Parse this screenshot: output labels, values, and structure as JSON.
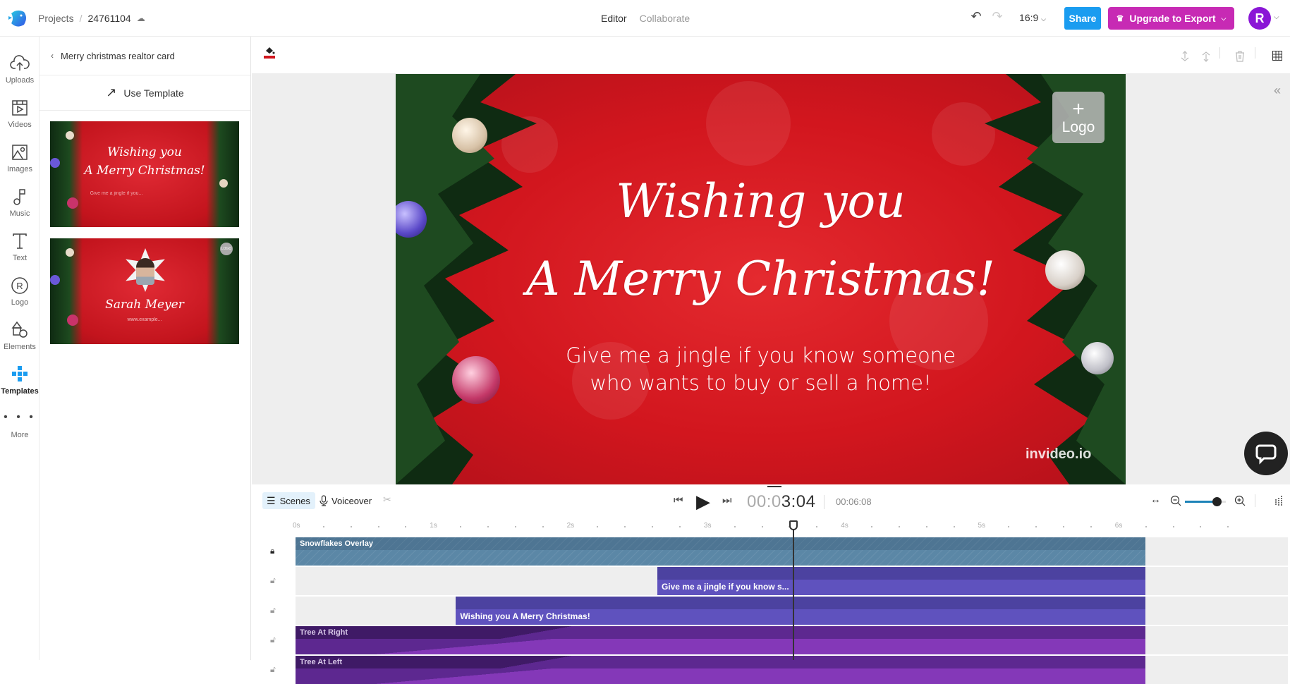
{
  "header": {
    "breadcrumb": {
      "projects": "Projects",
      "project_id": "24761104"
    },
    "modes": {
      "editor": "Editor",
      "collaborate": "Collaborate"
    },
    "aspect_ratio": "16:9",
    "share_label": "Share",
    "upgrade_label": "Upgrade to Export",
    "avatar_initial": "R",
    "colors": {
      "share": "#1a9cf0",
      "upgrade": "#c72ab4",
      "avatar": "#8a16d6"
    }
  },
  "rail": {
    "items": [
      {
        "label": "Uploads",
        "icon": "cloud-upload-icon"
      },
      {
        "label": "Videos",
        "icon": "video-icon"
      },
      {
        "label": "Images",
        "icon": "image-icon"
      },
      {
        "label": "Music",
        "icon": "music-icon"
      },
      {
        "label": "Text",
        "icon": "text-icon"
      },
      {
        "label": "Logo",
        "icon": "registered-icon"
      },
      {
        "label": "Elements",
        "icon": "shapes-icon"
      },
      {
        "label": "Templates",
        "icon": "templates-icon",
        "active": true
      },
      {
        "label": "More",
        "icon": "more-icon"
      }
    ]
  },
  "panel": {
    "title": "Merry christmas realtor card",
    "use_template": "Use Template",
    "thumbs": [
      {
        "line1": "Wishing you",
        "line2": "A Merry Christmas!",
        "line3": "Give me a jingle if you..."
      },
      {
        "line1": "Sarah Meyer",
        "line2": "www.example...",
        "badge": "LOGO"
      }
    ]
  },
  "canvas": {
    "headline_1": "Wishing you",
    "headline_2": "A Merry Christmas!",
    "sub_1": "Give me a jingle if you know someone",
    "sub_2": "who wants to buy or sell a home!",
    "logo_placeholder": "Logo",
    "logo_plus": "+",
    "watermark": "invideo.io",
    "bg_color": "#d2161e"
  },
  "timeline": {
    "scenes_label": "Scenes",
    "voiceover_label": "Voiceover",
    "current_time_dim": "00:0",
    "current_time": "3:04",
    "total_time": "00:06:08",
    "zoom_level": 0.78,
    "ruler": [
      "0s",
      "1s",
      "2s",
      "3s",
      "4s",
      "5s",
      "6s"
    ],
    "tracks": [
      {
        "name": "Snowflakes Overlay",
        "locked": true,
        "start": 0,
        "end": 6.2,
        "color_top": "#4e7593",
        "color_bot": "#5b87a6"
      },
      {
        "name": "Give me a jingle if you know s...",
        "locked": false,
        "start": 2.64,
        "end": 6.2,
        "color_top": "#4c42a0",
        "color_bot": "#5f52be"
      },
      {
        "name": "Wishing you A Merry Christmas!",
        "locked": false,
        "start": 1.17,
        "end": 6.2,
        "color_top": "#4c42a0",
        "color_bot": "#5f52be"
      },
      {
        "name": "Tree At Right",
        "locked": false,
        "start": 0,
        "end": 6.2,
        "color_top": "#5d2890",
        "color_bot": "#8438b8"
      },
      {
        "name": "Tree At Left",
        "locked": false,
        "start": 0,
        "end": 6.2,
        "color_top": "#5d2890",
        "color_bot": "#8438b8"
      }
    ]
  }
}
